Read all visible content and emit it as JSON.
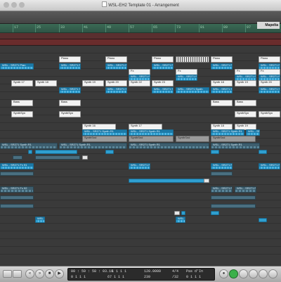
{
  "window": {
    "title": "WSL-EH2 Template 01 - Arrangement"
  },
  "ruler": {
    "bars": [
      "",
      "17",
      "25",
      "33",
      "41",
      "49",
      "57",
      "65",
      "73",
      "81",
      "89",
      "97",
      ""
    ],
    "marker_label": "Mapelta"
  },
  "regions": {
    "piano": [
      "Piano",
      "Piano",
      "Piano",
      "Piano",
      "Piano"
    ],
    "piano_blue": [
      "WSL - SR271 Pian",
      "WSL - SR271 Pian",
      "WSL - SR271 Pian",
      "WSL - SR271 Pian",
      "WSL - SR271 Pian",
      "WSL - SR271 Pian"
    ],
    "fx": [
      "Fx",
      "Fx",
      "Fx",
      "Fx"
    ],
    "fx_blue": [
      "WSL - SR271 Fx",
      "WSL - SR271 Fx",
      "WSL - SR271 Fx",
      "WSL - SR271 Fx"
    ],
    "synth_a": [
      "Synth 17",
      "Synth 18",
      "Synth 19",
      "Synth 20",
      "Synth 21",
      "Synth 22",
      "Synth 23",
      "Synth 18",
      "Synth 19",
      "Synth 20"
    ],
    "synth_a_blue": [
      "WSL - SR271 Synth",
      "WSL - SR271 Synth",
      "WSL - SR271 Synth",
      "WSL - SR271 Synth",
      "WSL - SR271 Synth",
      "WSL - SR271 Synth"
    ],
    "bass": [
      "Bass",
      "Bass",
      "Bass",
      "Bass"
    ],
    "synthsyn": [
      "SynthSyn",
      "SynthSyn",
      "SynthSyn",
      "SynthSyn"
    ],
    "synth_b": [
      "Synth 16",
      "Synth 17",
      "Synth 18",
      "Synth 19"
    ],
    "synth_b_blue": [
      "WSL - SR271 Synth R1",
      "WSL - SR271 Synth R1",
      "WSL - SR271 Synth R1",
      "WSL - SR271 Synth R1"
    ],
    "synthsnd": [
      "SynthSnd",
      "SynthSnd",
      "SynthSnd",
      "SynthSnd"
    ],
    "loop_blue": [
      "WSL - SR271 Synth R1",
      "WSL - SR271 Synth R1",
      "WSL - SR271 Synth R1",
      "WSL - SR271 Synth R1"
    ],
    "fx2_blue": [
      "WSL - SR271 Fx 91",
      "WSL - SR271 Fx 91",
      "WSL - SR271 Fx 91"
    ],
    "fx3_dark": [
      "WSL - SR271 Fx 92",
      "WSL - SR271 Fx 92",
      "WSL - SR271 Fx 92"
    ],
    "pad": [
      "WSL - SR271 Pad",
      "WSL - SR271 Pad"
    ]
  },
  "transport": {
    "position": "00 : 59 : 58 : 03.10",
    "bars": "1   1   1   1",
    "tempo": "120.0000",
    "signature": "4/4",
    "in_out": "Pas d'In",
    "line2_a": "0   1   1   1",
    "line2_b": "67   1   1   1",
    "line2_c": "239",
    "line2_d": "/32",
    "line2_e": "0 1   1   1",
    "rewind": "«",
    "forward": "»",
    "stop": "■",
    "play": "▶",
    "record": "●"
  }
}
